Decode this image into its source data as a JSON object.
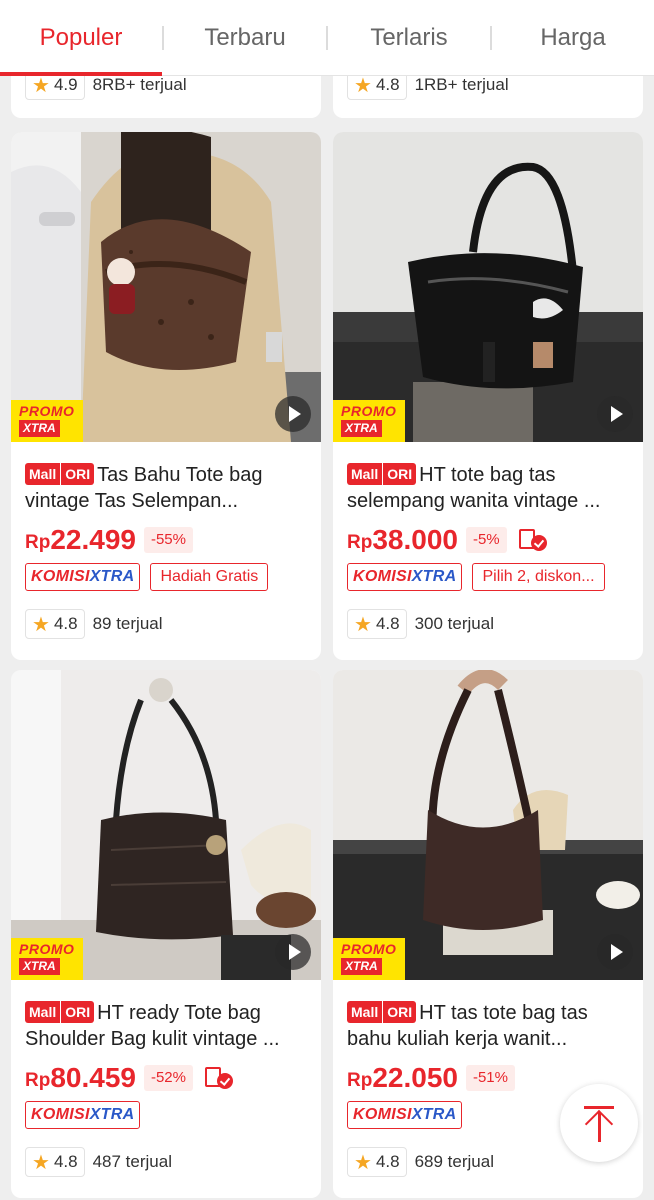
{
  "tabs": [
    "Populer",
    "Terbaru",
    "Terlaris",
    "Harga"
  ],
  "partial_cards": [
    {
      "rating": "4.9",
      "sold": "8RB+ terjual"
    },
    {
      "rating": "4.8",
      "sold": "1RB+ terjual"
    }
  ],
  "products": [
    {
      "mall": "Mall",
      "ori": "ORI",
      "title": "Tas Bahu Tote bag vintage Tas Selempan...",
      "currency": "Rp",
      "price": "22.499",
      "discount": "-55%",
      "komisi": "KOMISI",
      "xtra": "XTRA",
      "promo_top": "PROMO",
      "promo_bottom": "XTRA",
      "gift": "Hadiah Gratis",
      "rating": "4.8",
      "sold": "89 terjual"
    },
    {
      "mall": "Mall",
      "ori": "ORI",
      "title": "HT tote bag tas selempang wanita vintage ...",
      "currency": "Rp",
      "price": "38.000",
      "discount": "-5%",
      "komisi": "KOMISI",
      "xtra": "XTRA",
      "promo_top": "PROMO",
      "promo_bottom": "XTRA",
      "gift": "Pilih 2, diskon...",
      "rating": "4.8",
      "sold": "300 terjual"
    },
    {
      "mall": "Mall",
      "ori": "ORI",
      "title": "HT ready Tote bag Shoulder Bag kulit vintage ...",
      "currency": "Rp",
      "price": "80.459",
      "discount": "-52%",
      "komisi": "KOMISI",
      "xtra": "XTRA",
      "promo_top": "PROMO",
      "promo_bottom": "XTRA",
      "rating": "4.8",
      "sold": "487 terjual"
    },
    {
      "mall": "Mall",
      "ori": "ORI",
      "title": "HT tas tote bag tas bahu kuliah kerja wanit...",
      "currency": "Rp",
      "price": "22.050",
      "discount": "-51%",
      "komisi": "KOMISI",
      "xtra": "XTRA",
      "promo_top": "PROMO",
      "promo_bottom": "XTRA",
      "rating": "4.8",
      "sold": "689 terjual"
    }
  ],
  "colors": {
    "accent": "#e8262c",
    "xtra_blue": "#2a58c8",
    "promo_yellow": "#ffe400",
    "star": "#f5a623"
  },
  "icons": {
    "play": "play-icon",
    "star": "star-icon",
    "voucher": "voucher-check-icon",
    "back_to_top": "arrow-up-icon"
  }
}
